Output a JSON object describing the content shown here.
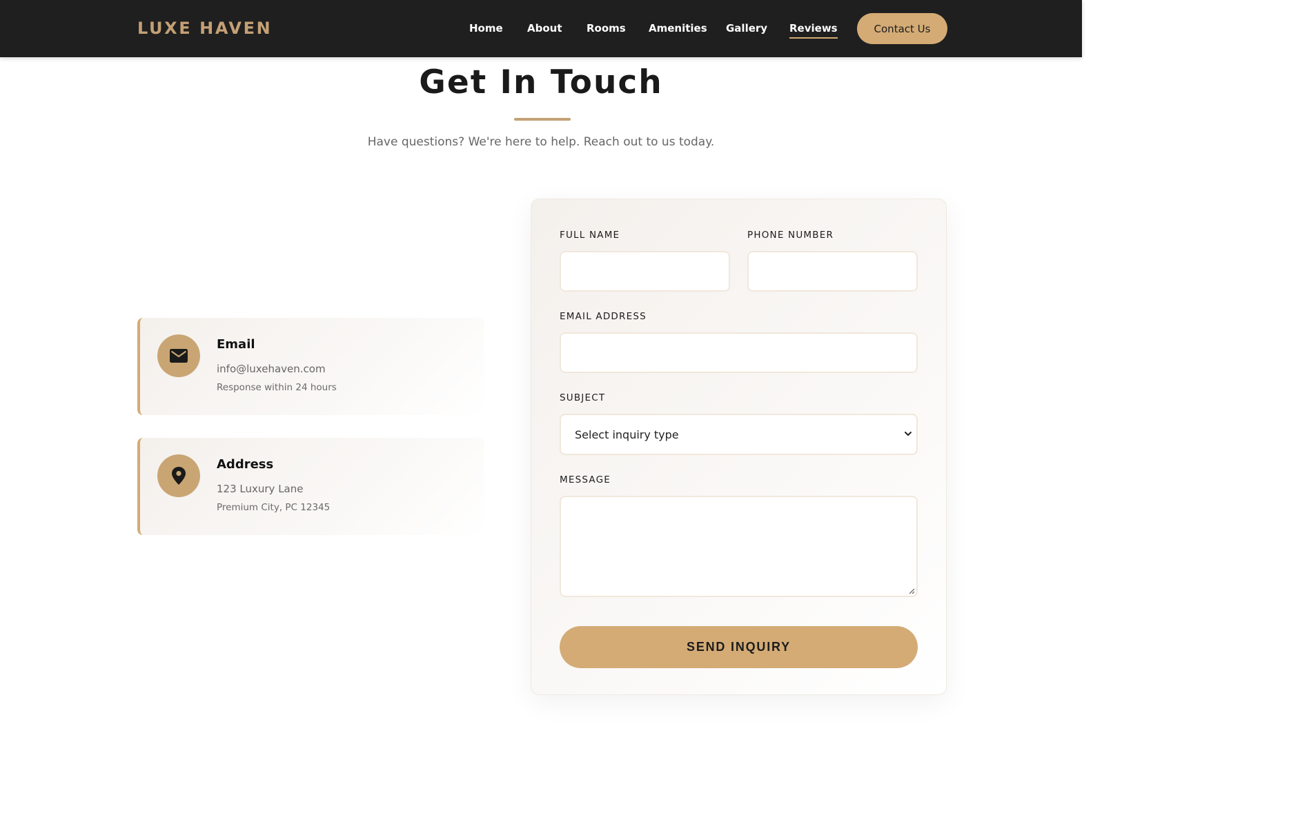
{
  "brand": {
    "name": "LUXE HAVEN"
  },
  "nav": {
    "items": [
      {
        "label": "Home"
      },
      {
        "label": "About"
      },
      {
        "label": "Rooms"
      },
      {
        "label": "Amenities"
      },
      {
        "label": "Gallery"
      },
      {
        "label": "Reviews",
        "active": true
      }
    ],
    "cta_label": "Contact Us"
  },
  "section": {
    "title": "Get In Touch",
    "subtitle": "Have questions? We're here to help. Reach out to us today."
  },
  "contact_cards": [
    {
      "icon": "envelope-icon",
      "title": "Email",
      "line1": "info@luxehaven.com",
      "line2": "Response within 24 hours"
    },
    {
      "icon": "map-pin-icon",
      "title": "Address",
      "line1": "123 Luxury Lane",
      "line2": "Premium City, PC 12345"
    }
  ],
  "form": {
    "full_name_label": "FULL NAME",
    "full_name_value": "",
    "phone_label": "PHONE NUMBER",
    "phone_value": "",
    "email_label": "EMAIL ADDRESS",
    "email_value": "",
    "subject_label": "SUBJECT",
    "subject_selected": "Select inquiry type",
    "message_label": "MESSAGE",
    "message_value": "",
    "submit_label": "SEND INQUIRY"
  },
  "colors": {
    "nav_background": "#1f1f1f",
    "accent_gold": "#d4ab75",
    "brand_gold": "#c4a075",
    "heading_dark": "#1a1a1a",
    "muted_text": "#666666"
  }
}
